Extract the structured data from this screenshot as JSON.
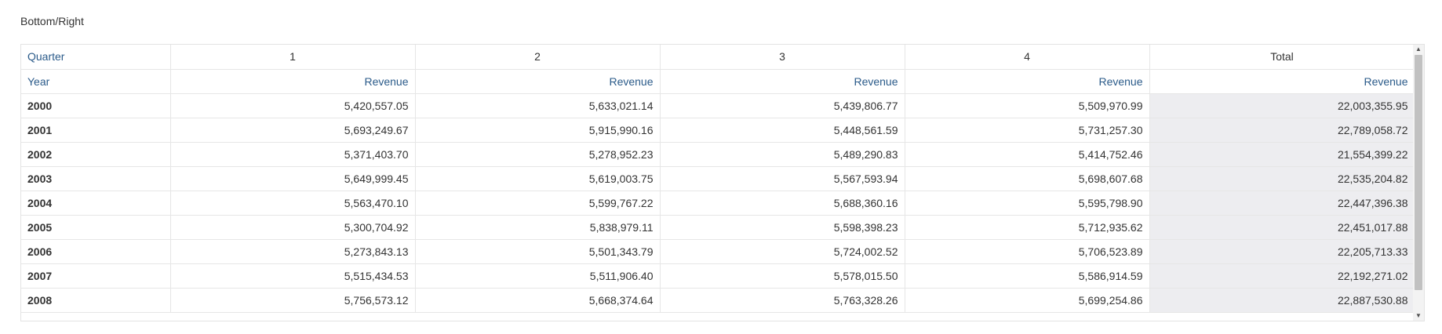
{
  "title": "Bottom/Right",
  "pivot": {
    "column_dim_label": "Quarter",
    "row_dim_label": "Year",
    "quarters": [
      "1",
      "2",
      "3",
      "4",
      "Total"
    ],
    "measure_label": "Revenue",
    "rows": [
      {
        "year": "2000",
        "values": [
          "5,420,557.05",
          "5,633,021.14",
          "5,439,806.77",
          "5,509,970.99",
          "22,003,355.95"
        ]
      },
      {
        "year": "2001",
        "values": [
          "5,693,249.67",
          "5,915,990.16",
          "5,448,561.59",
          "5,731,257.30",
          "22,789,058.72"
        ]
      },
      {
        "year": "2002",
        "values": [
          "5,371,403.70",
          "5,278,952.23",
          "5,489,290.83",
          "5,414,752.46",
          "21,554,399.22"
        ]
      },
      {
        "year": "2003",
        "values": [
          "5,649,999.45",
          "5,619,003.75",
          "5,567,593.94",
          "5,698,607.68",
          "22,535,204.82"
        ]
      },
      {
        "year": "2004",
        "values": [
          "5,563,470.10",
          "5,599,767.22",
          "5,688,360.16",
          "5,595,798.90",
          "22,447,396.38"
        ]
      },
      {
        "year": "2005",
        "values": [
          "5,300,704.92",
          "5,838,979.11",
          "5,598,398.23",
          "5,712,935.62",
          "22,451,017.88"
        ]
      },
      {
        "year": "2006",
        "values": [
          "5,273,843.13",
          "5,501,343.79",
          "5,724,002.52",
          "5,706,523.89",
          "22,205,713.33"
        ]
      },
      {
        "year": "2007",
        "values": [
          "5,515,434.53",
          "5,511,906.40",
          "5,578,015.50",
          "5,586,914.59",
          "22,192,271.02"
        ]
      },
      {
        "year": "2008",
        "values": [
          "5,756,573.12",
          "5,668,374.64",
          "5,763,328.26",
          "5,699,254.86",
          "22,887,530.88"
        ]
      }
    ],
    "scrollbar": {
      "up_icon": "triangle-up",
      "down_icon": "triangle-down"
    }
  }
}
